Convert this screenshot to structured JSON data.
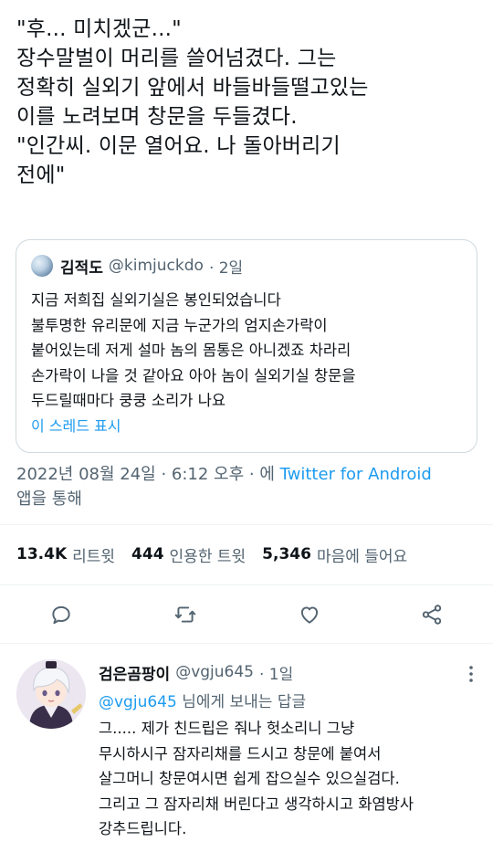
{
  "tweet": {
    "text_lines": [
      "\"후... 미치겠군...\"",
      "장수말벌이 머리를 쓸어넘겼다. 그는",
      "정확히 실외기 앞에서 바들바들떨고있는",
      "이를 노려보며 창문을 두들겼다.",
      "\"인간씨. 이문 열어요. 나 돌아버리기",
      "전에\""
    ],
    "quoted": {
      "display_name": "김적도",
      "handle": "@kimjuckdo",
      "age": "· 2일",
      "body_lines": [
        "지금 저희집 실외기실은 봉인되었습니다",
        "불투명한 유리문에 지금 누군가의 엄지손가락이",
        "붙어있는데 저게 설마 놈의 몸통은 아니겠죠 차라리",
        "손가락이 나을 것 같아요 아아 놈이 실외기실 창문을",
        "두드릴때마다 쿵쿵 소리가 나요"
      ],
      "show_thread": "이 스레드 표시"
    },
    "meta": {
      "datetime": "2022년 08월 24일 · 6:12 오후 · 에",
      "source": "Twitter for Android",
      "suffix": "앱을 통해"
    },
    "stats": [
      {
        "value": "13.4K",
        "label": "리트윗"
      },
      {
        "value": "444",
        "label": "인용한 트윗"
      },
      {
        "value": "5,346",
        "label": "마음에 들어요"
      }
    ],
    "actions": [
      "reply-icon",
      "retweet-icon",
      "like-icon",
      "share-icon"
    ]
  },
  "reply": {
    "display_name": "검은곰팡이",
    "handle": "@vgju645",
    "age": "· 1일",
    "reply_to_mention": "@vgju645",
    "reply_to_suffix": "님에게 보내는 답글",
    "body_lines": [
      "그.....  제가 친드립은 줘나 헛소리니 그냥",
      "무시하시구 잠자리채를 드시고 창문에 붙여서",
      "살그머니 창문여시면 쉽게 잡으실수 있으실검다.",
      "그리고 그 잠자리채 버린다고 생각하시고 화염방사",
      "강추드립니다."
    ]
  },
  "colors": {
    "text": "#0f1419",
    "secondary": "#536471",
    "accent": "#1d9bf0",
    "border": "#cfd9de"
  }
}
